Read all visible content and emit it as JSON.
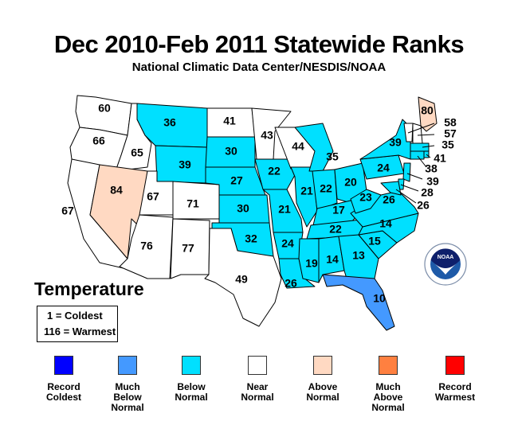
{
  "header": {
    "title": "Dec 2010-Feb 2011 Statewide Ranks",
    "subtitle": "National Climatic Data Center/NESDIS/NOAA"
  },
  "variable": "Temperature",
  "scale": {
    "coldest": "1 = Coldest",
    "warmest": "116 = Warmest"
  },
  "colors": {
    "record_coldest": "#0000ff",
    "much_below": "#4499ff",
    "below": "#00e0ff",
    "near": "#ffffff",
    "above": "#ffd9c2",
    "much_above": "#ff8040",
    "record_warmest": "#ff0000"
  },
  "legend": [
    {
      "key": "record_coldest",
      "label": "Record\nColdest",
      "color": "#0000ff"
    },
    {
      "key": "much_below",
      "label": "Much\nBelow\nNormal",
      "color": "#4499ff"
    },
    {
      "key": "below",
      "label": "Below\nNormal",
      "color": "#00e0ff"
    },
    {
      "key": "near",
      "label": "Near\nNormal",
      "color": "#ffffff"
    },
    {
      "key": "above",
      "label": "Above\nNormal",
      "color": "#ffd9c2"
    },
    {
      "key": "much_above",
      "label": "Much\nAbove\nNormal",
      "color": "#ff8040"
    },
    {
      "key": "record_warmest",
      "label": "Record\nWarmest",
      "color": "#ff0000"
    }
  ],
  "states": {
    "WA": {
      "rank": "60",
      "category": "near"
    },
    "OR": {
      "rank": "66",
      "category": "near"
    },
    "CA": {
      "rank": "67",
      "category": "near"
    },
    "ID": {
      "rank": "65",
      "category": "near"
    },
    "NV": {
      "rank": "84",
      "category": "above"
    },
    "MT": {
      "rank": "36",
      "category": "below"
    },
    "WY": {
      "rank": "39",
      "category": "below"
    },
    "UT": {
      "rank": "67",
      "category": "near"
    },
    "CO": {
      "rank": "71",
      "category": "near"
    },
    "AZ": {
      "rank": "76",
      "category": "near"
    },
    "NM": {
      "rank": "77",
      "category": "near"
    },
    "ND": {
      "rank": "41",
      "category": "near"
    },
    "SD": {
      "rank": "30",
      "category": "below"
    },
    "NE": {
      "rank": "27",
      "category": "below"
    },
    "KS": {
      "rank": "30",
      "category": "below"
    },
    "OK": {
      "rank": "32",
      "category": "below"
    },
    "TX": {
      "rank": "49",
      "category": "near"
    },
    "MN": {
      "rank": "43",
      "category": "near"
    },
    "IA": {
      "rank": "22",
      "category": "below"
    },
    "MO": {
      "rank": "21",
      "category": "below"
    },
    "AR": {
      "rank": "24",
      "category": "below"
    },
    "LA": {
      "rank": "26",
      "category": "below"
    },
    "WI": {
      "rank": "44",
      "category": "near"
    },
    "IL": {
      "rank": "21",
      "category": "below"
    },
    "MI": {
      "rank": "35",
      "category": "below"
    },
    "IN": {
      "rank": "22",
      "category": "below"
    },
    "OH": {
      "rank": "20",
      "category": "below"
    },
    "KY": {
      "rank": "17",
      "category": "below"
    },
    "TN": {
      "rank": "22",
      "category": "below"
    },
    "MS": {
      "rank": "19",
      "category": "below"
    },
    "AL": {
      "rank": "14",
      "category": "below"
    },
    "GA": {
      "rank": "13",
      "category": "below"
    },
    "FL": {
      "rank": "10",
      "category": "much_below"
    },
    "SC": {
      "rank": "15",
      "category": "below"
    },
    "NC": {
      "rank": "14",
      "category": "below"
    },
    "VA": {
      "rank": "26",
      "category": "below"
    },
    "WV": {
      "rank": "23",
      "category": "below"
    },
    "PA": {
      "rank": "24",
      "category": "below"
    },
    "NY": {
      "rank": "39",
      "category": "below"
    },
    "ME": {
      "rank": "80",
      "category": "above"
    },
    "VT": {
      "rank": "58",
      "category": "near"
    },
    "NH": {
      "rank": "57",
      "category": "near"
    },
    "MA": {
      "rank": "35",
      "category": "below"
    },
    "RI": {
      "rank": "41",
      "category": "below"
    },
    "CT": {
      "rank": "38",
      "category": "below"
    },
    "NJ": {
      "rank": "39",
      "category": "below"
    },
    "DE": {
      "rank": "28",
      "category": "below"
    },
    "MD": {
      "rank": "26",
      "category": "below"
    }
  },
  "logo": {
    "text": "NOAA"
  }
}
